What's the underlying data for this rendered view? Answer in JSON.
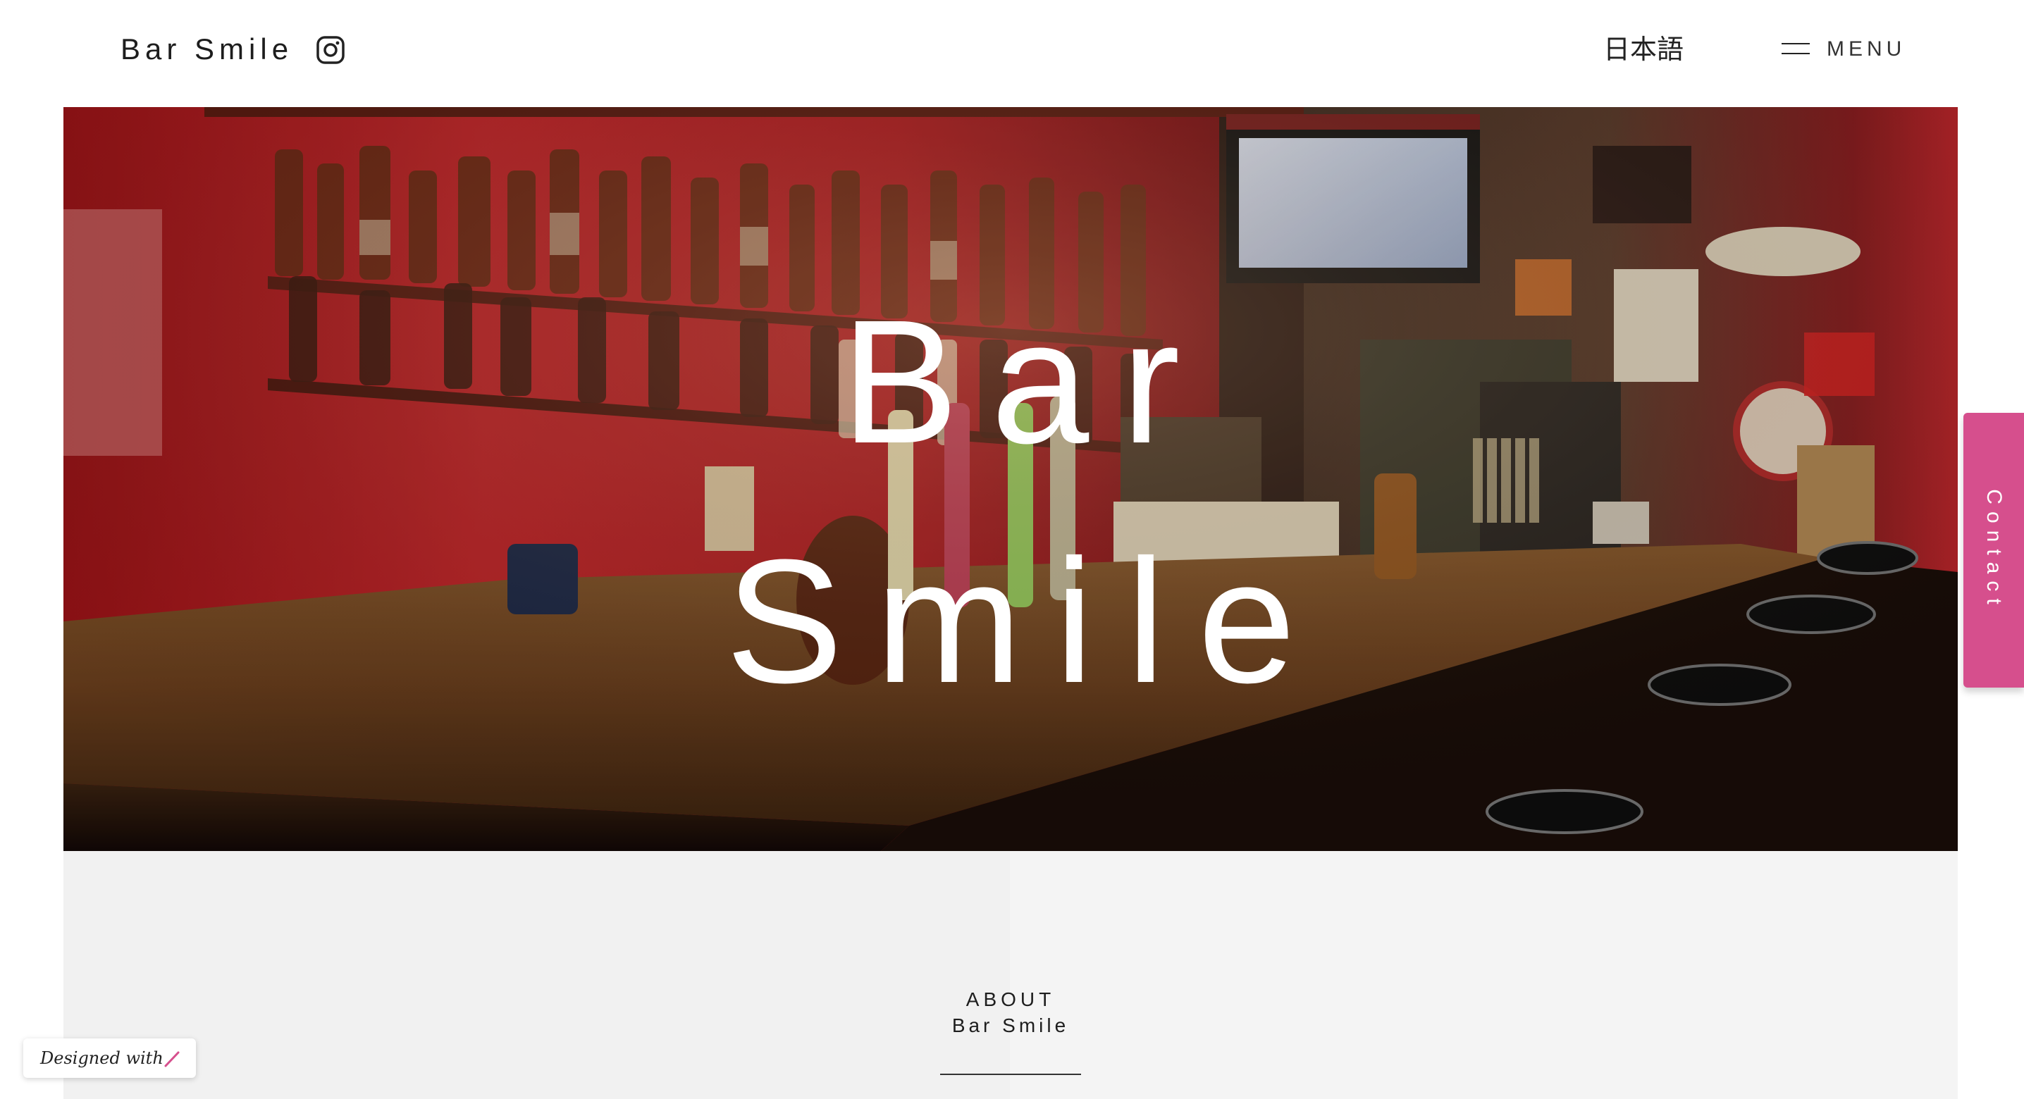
{
  "header": {
    "brand": "Bar Smile",
    "instagram_icon": "instagram-icon",
    "language": "日本語",
    "menu_label": "MENU",
    "menu_icon": "hamburger-icon"
  },
  "hero": {
    "title_line1": "Bar",
    "title_line2": "Smile",
    "image": "bar-counter-photo"
  },
  "about": {
    "heading": "ABOUT",
    "subheading": "Bar Smile"
  },
  "contact_tab": {
    "label": "Contact"
  },
  "badge": {
    "label": "Designed with",
    "icon": "pen-icon"
  },
  "colors": {
    "accent": "#d64f8d",
    "about_bg": "#f4f4f4",
    "hero_red": "#b81e22"
  }
}
